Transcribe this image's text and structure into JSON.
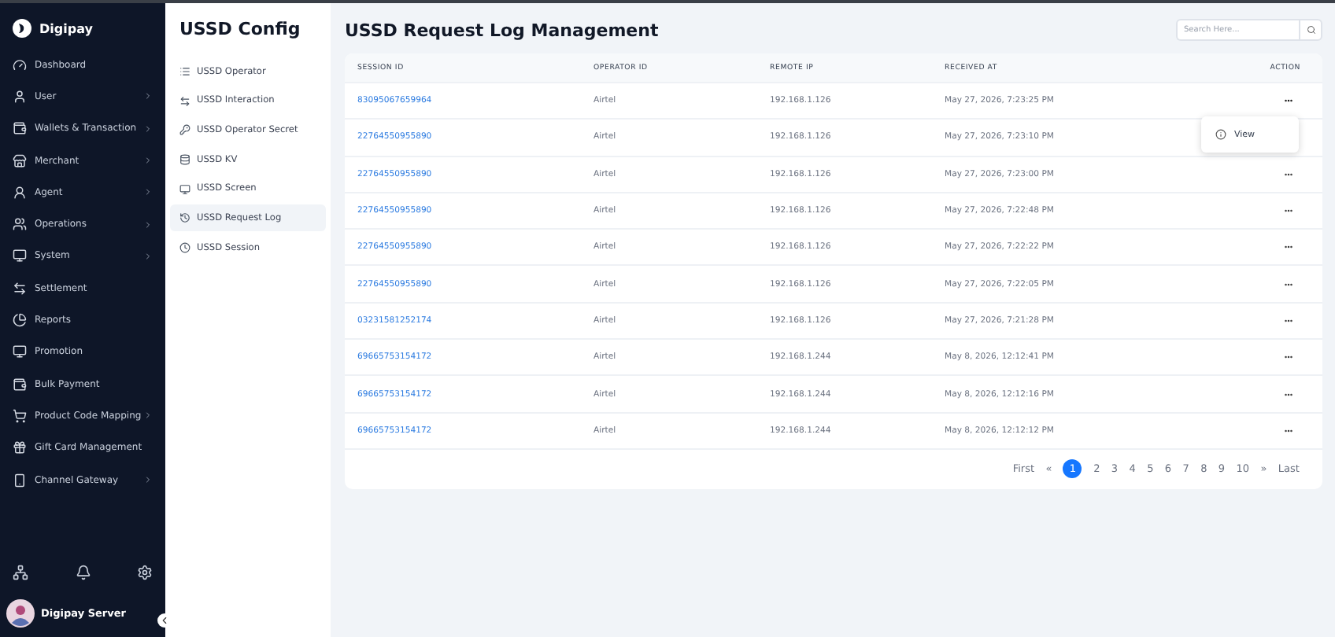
{
  "brand": {
    "name": "Digipay"
  },
  "sidebar": {
    "items": [
      {
        "label": "Dashboard",
        "expandable": false
      },
      {
        "label": "User",
        "expandable": true
      },
      {
        "label": "Wallets & Transaction",
        "expandable": true
      },
      {
        "label": "Merchant",
        "expandable": true
      },
      {
        "label": "Agent",
        "expandable": true
      },
      {
        "label": "Operations",
        "expandable": true
      },
      {
        "label": "System",
        "expandable": true
      },
      {
        "label": "Settlement",
        "expandable": false
      },
      {
        "label": "Reports",
        "expandable": false
      },
      {
        "label": "Promotion",
        "expandable": false
      },
      {
        "label": "Bulk Payment",
        "expandable": false
      },
      {
        "label": "Product Code Mapping",
        "expandable": true
      },
      {
        "label": "Gift Card Management",
        "expandable": false
      },
      {
        "label": "Channel Gateway",
        "expandable": true
      }
    ],
    "user": {
      "name": "Digipay Server"
    }
  },
  "submenu": {
    "title": "USSD Config",
    "items": [
      {
        "label": "USSD Operator",
        "selected": false
      },
      {
        "label": "USSD Interaction",
        "selected": false
      },
      {
        "label": "USSD Operator Secret",
        "selected": false
      },
      {
        "label": "USSD KV",
        "selected": false
      },
      {
        "label": "USSD Screen",
        "selected": false
      },
      {
        "label": "USSD Request Log",
        "selected": true
      },
      {
        "label": "USSD Session",
        "selected": false
      }
    ]
  },
  "page": {
    "title": "USSD Request Log Management",
    "search": {
      "placeholder": "Search Here..."
    }
  },
  "table": {
    "columns": [
      "SESSION ID",
      "OPERATOR ID",
      "REMOTE IP",
      "RECEIVED AT",
      "ACTION"
    ],
    "rows": [
      {
        "session_id": "83095067659964",
        "operator_id": "Airtel",
        "remote_ip": "192.168.1.126",
        "received_at": "May 27, 2026, 7:23:25 PM",
        "menu_open": true
      },
      {
        "session_id": "22764550955890",
        "operator_id": "Airtel",
        "remote_ip": "192.168.1.126",
        "received_at": "May 27, 2026, 7:23:10 PM",
        "menu_open": false
      },
      {
        "session_id": "22764550955890",
        "operator_id": "Airtel",
        "remote_ip": "192.168.1.126",
        "received_at": "May 27, 2026, 7:23:00 PM",
        "menu_open": false
      },
      {
        "session_id": "22764550955890",
        "operator_id": "Airtel",
        "remote_ip": "192.168.1.126",
        "received_at": "May 27, 2026, 7:22:48 PM",
        "menu_open": false
      },
      {
        "session_id": "22764550955890",
        "operator_id": "Airtel",
        "remote_ip": "192.168.1.126",
        "received_at": "May 27, 2026, 7:22:22 PM",
        "menu_open": false
      },
      {
        "session_id": "22764550955890",
        "operator_id": "Airtel",
        "remote_ip": "192.168.1.126",
        "received_at": "May 27, 2026, 7:22:05 PM",
        "menu_open": false
      },
      {
        "session_id": "03231581252174",
        "operator_id": "Airtel",
        "remote_ip": "192.168.1.126",
        "received_at": "May 27, 2026, 7:21:28 PM",
        "menu_open": false
      },
      {
        "session_id": "69665753154172",
        "operator_id": "Airtel",
        "remote_ip": "192.168.1.244",
        "received_at": "May 8, 2026, 12:12:41 PM",
        "menu_open": false
      },
      {
        "session_id": "69665753154172",
        "operator_id": "Airtel",
        "remote_ip": "192.168.1.244",
        "received_at": "May 8, 2026, 12:12:16 PM",
        "menu_open": false
      },
      {
        "session_id": "69665753154172",
        "operator_id": "Airtel",
        "remote_ip": "192.168.1.244",
        "received_at": "May 8, 2026, 12:12:12 PM",
        "menu_open": false
      }
    ],
    "action_menu": {
      "items": [
        "View"
      ]
    }
  },
  "pagination": {
    "first": "First",
    "prev": "«",
    "next": "»",
    "last": "Last",
    "pages": [
      {
        "label": "1",
        "selected": true
      },
      {
        "label": "2",
        "selected": false
      },
      {
        "label": "3",
        "selected": false
      },
      {
        "label": "4",
        "selected": false
      },
      {
        "label": "5",
        "selected": false
      },
      {
        "label": "6",
        "selected": false
      },
      {
        "label": "7",
        "selected": false
      },
      {
        "label": "8",
        "selected": false
      },
      {
        "label": "9",
        "selected": false
      },
      {
        "label": "10",
        "selected": false
      }
    ]
  }
}
